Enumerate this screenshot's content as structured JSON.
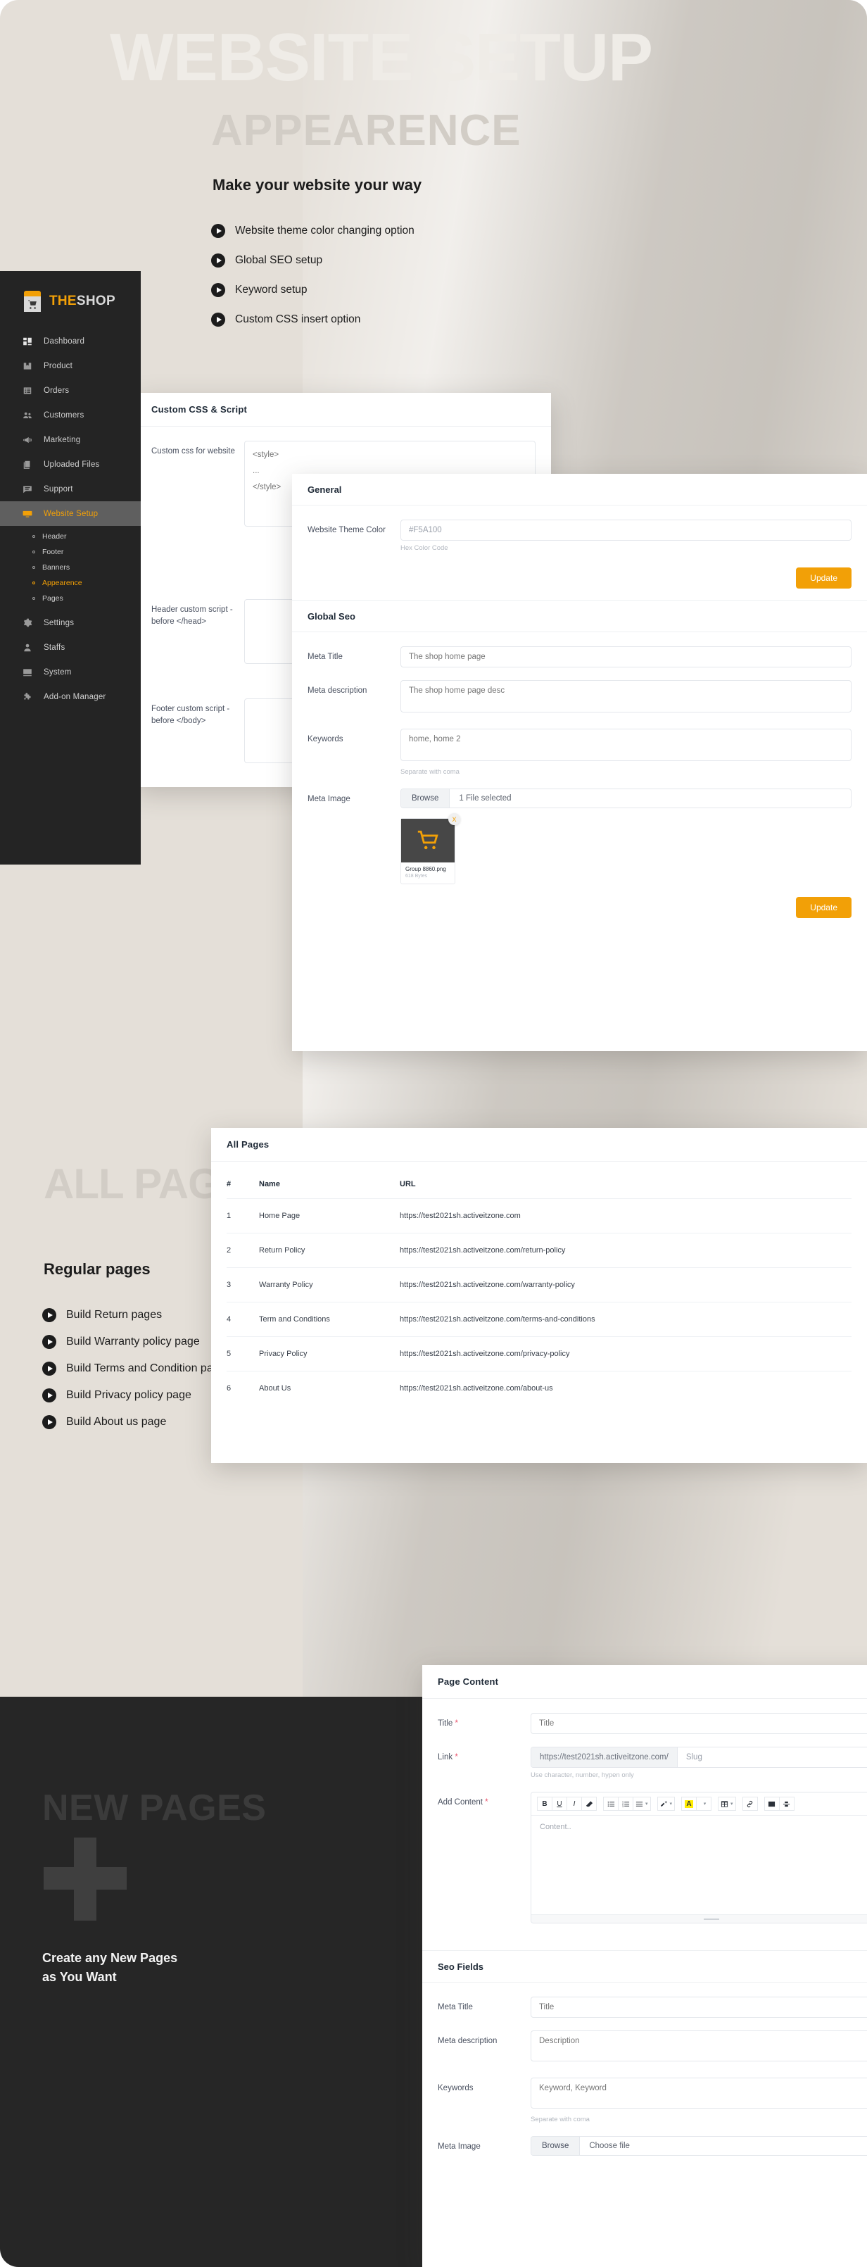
{
  "hero": {
    "ghost_title": "WEBSITE SETUP",
    "ghost_subtitle": "APPEARENCE",
    "heading": "Make your website your way",
    "bullets": [
      "Website theme color changing option",
      "Global SEO setup",
      "Keyword setup",
      "Custom CSS insert option"
    ]
  },
  "sidebar": {
    "logo": {
      "the": "THE",
      "shop": "SHOP"
    },
    "items": [
      {
        "label": "Dashboard",
        "icon": "grid-icon",
        "active": false
      },
      {
        "label": "Product",
        "icon": "box-icon",
        "active": false
      },
      {
        "label": "Orders",
        "icon": "list-icon",
        "active": false
      },
      {
        "label": "Customers",
        "icon": "users-icon",
        "active": false
      },
      {
        "label": "Marketing",
        "icon": "megaphone-icon",
        "active": false
      },
      {
        "label": "Uploaded Files",
        "icon": "files-icon",
        "active": false
      },
      {
        "label": "Support",
        "icon": "chat-icon",
        "active": false
      },
      {
        "label": "Website Setup",
        "icon": "monitor-icon",
        "active": true
      }
    ],
    "sub_items": [
      {
        "label": "Header",
        "active": false
      },
      {
        "label": "Footer",
        "active": false
      },
      {
        "label": "Banners",
        "active": false
      },
      {
        "label": "Appearence",
        "active": true
      },
      {
        "label": "Pages",
        "active": false
      }
    ],
    "items_after": [
      {
        "label": "Settings",
        "icon": "gear-icon"
      },
      {
        "label": "Staffs",
        "icon": "person-icon"
      },
      {
        "label": "System",
        "icon": "tools-icon"
      },
      {
        "label": "Add-on Manager",
        "icon": "puzzle-icon"
      }
    ]
  },
  "custom_css_card": {
    "title": "Custom CSS & Script",
    "fields": [
      {
        "label": "Custom css for website",
        "placeholder": "<style>\n...\n</style>"
      },
      {
        "label": "Header custom script - before </head>",
        "placeholder": ""
      },
      {
        "label": "Footer custom script - before </body>",
        "placeholder": ""
      }
    ]
  },
  "general_card": {
    "title": "General",
    "theme_color_label": "Website Theme Color",
    "theme_color_value": "#F5A100",
    "theme_color_hint": "Hex Color Code",
    "update_label": "Update"
  },
  "global_seo_card": {
    "title": "Global Seo",
    "meta_title_label": "Meta Title",
    "meta_title_placeholder": "The shop home page",
    "meta_desc_label": "Meta description",
    "meta_desc_placeholder": "The shop home page desc",
    "keywords_label": "Keywords",
    "keywords_placeholder": "home, home 2",
    "keywords_hint": "Separate with coma",
    "meta_image_label": "Meta Image",
    "browse_label": "Browse",
    "file_status": "1 File selected",
    "thumb_name": "Group 8860.png",
    "thumb_size": "618 Bytes",
    "remove_icon": "X",
    "update_label": "Update"
  },
  "all_pages_section": {
    "ghost_title": "ALL PAGES",
    "heading": "Regular pages",
    "bullets": [
      "Build Return pages",
      "Build Warranty policy page",
      "Build Terms and Condition page",
      "Build Privacy policy page",
      "Build About us page"
    ],
    "card_title": "All Pages",
    "columns": [
      "#",
      "Name",
      "URL"
    ],
    "rows": [
      [
        "1",
        "Home Page",
        "https://test2021sh.activeitzone.com"
      ],
      [
        "2",
        "Return Policy",
        "https://test2021sh.activeitzone.com/return-policy"
      ],
      [
        "3",
        "Warranty Policy",
        "https://test2021sh.activeitzone.com/warranty-policy"
      ],
      [
        "4",
        "Term and Conditions",
        "https://test2021sh.activeitzone.com/terms-and-conditions"
      ],
      [
        "5",
        "Privacy Policy",
        "https://test2021sh.activeitzone.com/privacy-policy"
      ],
      [
        "6",
        "About Us",
        "https://test2021sh.activeitzone.com/about-us"
      ]
    ]
  },
  "new_pages_section": {
    "ghost_title": "NEW PAGES",
    "plus_icon": "plus-icon",
    "text": "Create any New Pages\nas You Want"
  },
  "page_content_card": {
    "title": "Page Content",
    "title_label": "Title",
    "title_placeholder": "Title",
    "link_label": "Link",
    "link_prefix": "https://test2021sh.activeitzone.com/",
    "link_placeholder": "Slug",
    "link_hint": "Use character, number, hypen only",
    "content_label": "Add Content",
    "content_placeholder": "Content..",
    "toolbar": [
      {
        "icon": "bold-icon",
        "label": "B"
      },
      {
        "icon": "underline-icon",
        "label": "U"
      },
      {
        "icon": "italic-icon",
        "label": "I"
      },
      {
        "icon": "eraser-icon",
        "label": ""
      },
      {
        "icon": "bullet-list-icon",
        "label": ""
      },
      {
        "icon": "numbered-list-icon",
        "label": ""
      },
      {
        "icon": "align-icon",
        "label": ""
      },
      {
        "icon": "magic-wand-icon",
        "label": ""
      },
      {
        "icon": "text-highlight-icon",
        "label": "A"
      },
      {
        "icon": "table-icon",
        "label": ""
      },
      {
        "icon": "link-icon",
        "label": ""
      },
      {
        "icon": "image-icon",
        "label": ""
      },
      {
        "icon": "page-break-icon",
        "label": ""
      }
    ]
  },
  "seo_fields_card": {
    "title": "Seo Fields",
    "meta_title_label": "Meta Title",
    "meta_title_placeholder": "Title",
    "meta_desc_label": "Meta description",
    "meta_desc_placeholder": "Description",
    "keywords_label": "Keywords",
    "keywords_placeholder": "Keyword, Keyword",
    "keywords_hint": "Separate with coma",
    "meta_image_label": "Meta Image",
    "browse_label": "Browse",
    "choose_file_label": "Choose file"
  },
  "colors": {
    "accent": "#F2A007",
    "sidebar_bg": "#242424",
    "hero_bg": "#E4DFD8",
    "dark_block": "#262626"
  }
}
